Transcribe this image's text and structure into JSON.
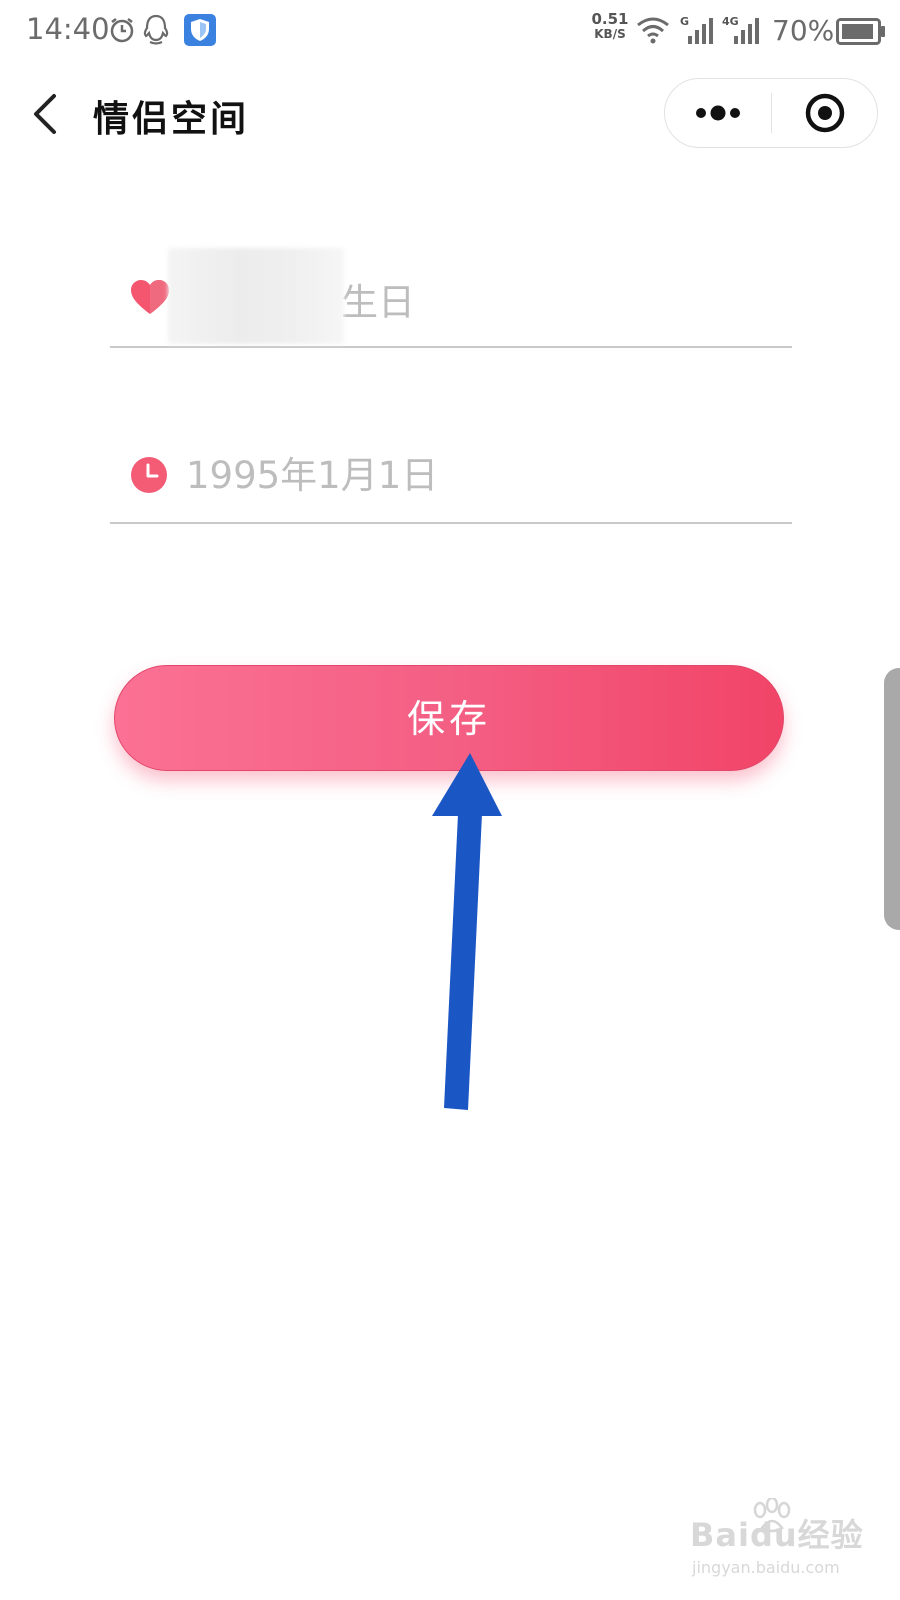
{
  "status_bar": {
    "time": "14:40",
    "net_speed_value": "0.51",
    "net_speed_unit": "KB/S",
    "signal_1_label": "G",
    "signal_2_label": "4G",
    "battery_percent": "70%"
  },
  "nav": {
    "title": "情侣空间"
  },
  "form": {
    "name_field": {
      "value": "生日",
      "icon": "heart-icon"
    },
    "date_field": {
      "placeholder": "1995年1月1日",
      "icon": "clock-icon"
    }
  },
  "save_button": {
    "label": "保存"
  },
  "watermark": {
    "brand": "Baidu经验",
    "url": "jingyan.baidu.com"
  },
  "colors": {
    "accent": "#f45f84",
    "arrow": "#1a56c4",
    "placeholder": "#bdbdbd"
  }
}
